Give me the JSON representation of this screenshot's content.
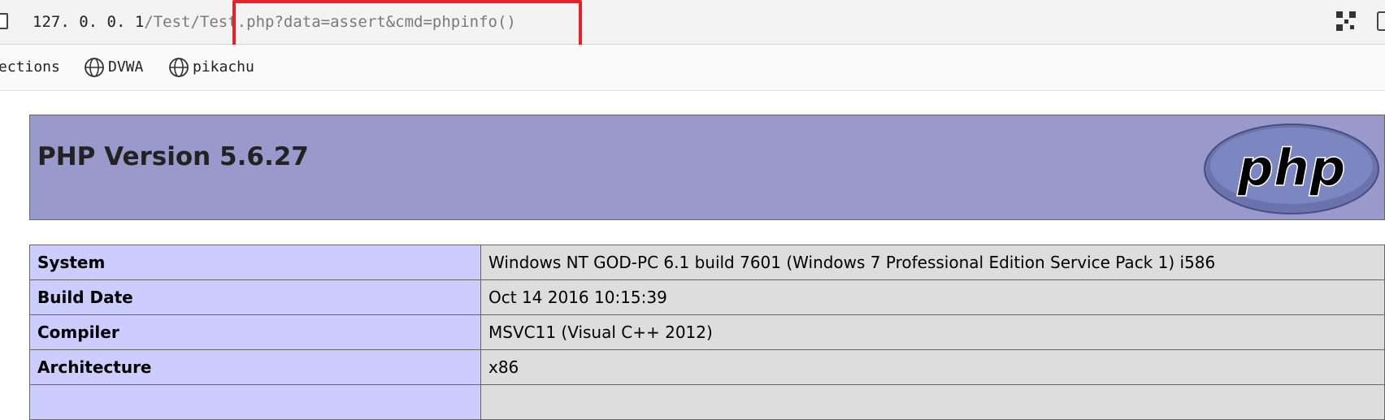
{
  "browser": {
    "url": {
      "host": "127. 0. 0. 1",
      "path": "/Test/Test.",
      "query": "php?data=assert&cmd=phpinfo()"
    },
    "bookmarks": [
      {
        "label": "ections",
        "icon": "none"
      },
      {
        "label": "DVWA",
        "icon": "globe-icon"
      },
      {
        "label": "pikachu",
        "icon": "globe-icon"
      }
    ],
    "colors": {
      "highlight_box": "#e8202a"
    }
  },
  "phpinfo": {
    "title": "PHP Version 5.6.27",
    "logo_text": "php",
    "colors": {
      "header_bg": "#9999cc",
      "label_bg": "#ccccff",
      "value_bg": "#dddddd"
    },
    "rows": [
      {
        "label": "System",
        "value": "Windows NT GOD-PC 6.1 build 7601 (Windows 7 Professional Edition Service Pack 1) i586"
      },
      {
        "label": "Build Date",
        "value": "Oct 14 2016 10:15:39"
      },
      {
        "label": "Compiler",
        "value": "MSVC11 (Visual C++ 2012)"
      },
      {
        "label": "Architecture",
        "value": "x86"
      },
      {
        "label": "",
        "value": ""
      }
    ]
  }
}
